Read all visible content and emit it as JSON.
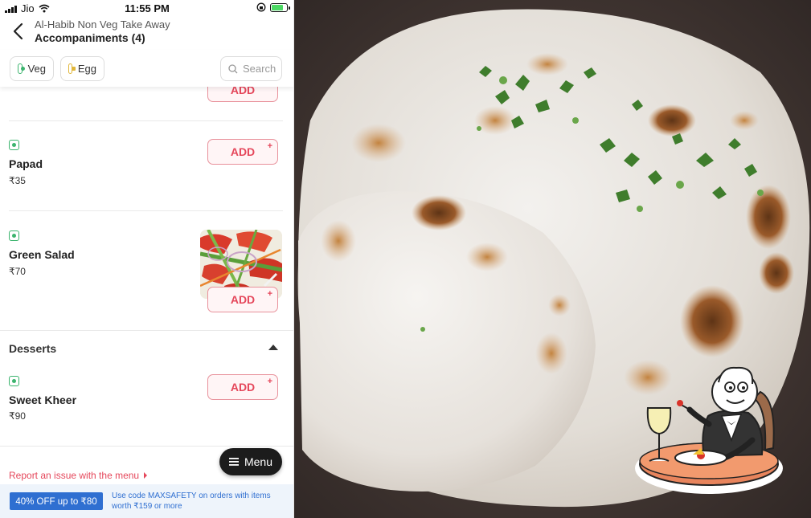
{
  "status_bar": {
    "carrier": "Jio",
    "time": "11:55 PM"
  },
  "header": {
    "restaurant_name": "Al-Habib Non Veg Take Away",
    "category_title": "Accompaniments (4)"
  },
  "filters": {
    "veg_label": "Veg",
    "egg_label": "Egg",
    "search_placeholder": "Search"
  },
  "add_label": "ADD",
  "add_plus": "+",
  "items": [
    {
      "name": "Papad",
      "price": "₹35"
    },
    {
      "name": "Green Salad",
      "price": "₹70"
    },
    {
      "name": "Sweet Kheer",
      "price": "₹90"
    }
  ],
  "section": {
    "title": "Desserts"
  },
  "report_link": "Report an issue with the menu",
  "menu_button": "Menu",
  "offer": {
    "badge": "40% OFF up to ₹80",
    "text": "Use code MAXSAFETY on orders with items worth ₹159 or more"
  },
  "colors": {
    "accent": "#e5475b",
    "veg_green": "#3cb46e",
    "egg_yellow": "#e0b63a",
    "offer_blue": "#2f6fd1"
  },
  "icons": [
    "signal-icon",
    "wifi-icon",
    "lock-rotation-icon",
    "battery-icon",
    "back-arrow-icon",
    "search-icon",
    "hamburger-icon",
    "diner-sticker-icon"
  ]
}
